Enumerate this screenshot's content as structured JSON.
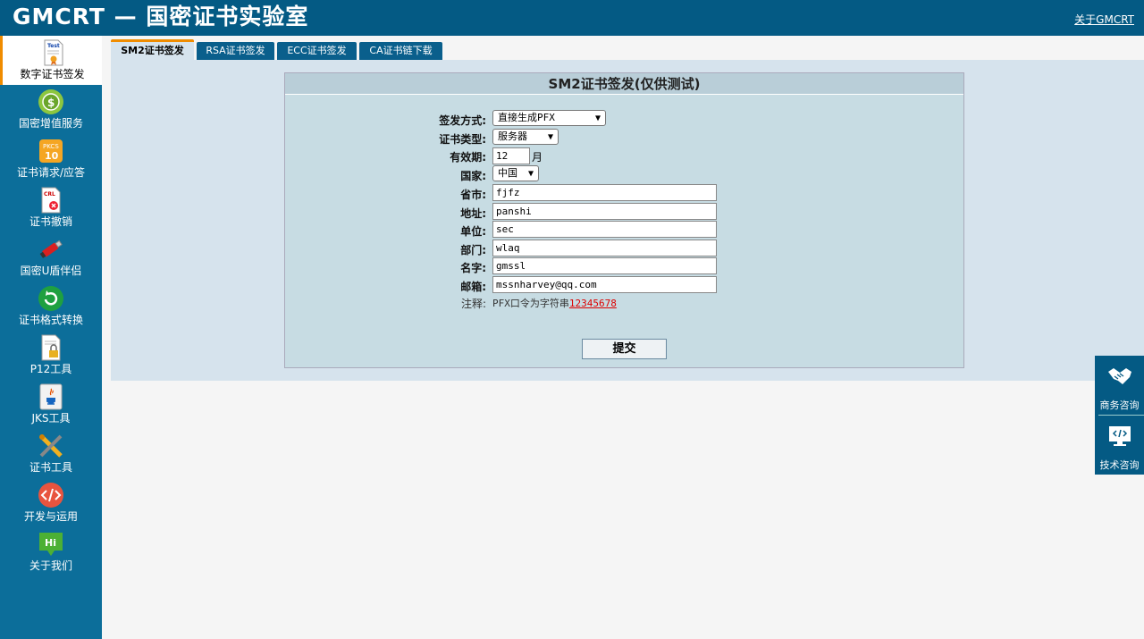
{
  "header": {
    "title": "GMCRT — 国密证书实验室",
    "about": "关于GMCRT"
  },
  "sidebar": {
    "items": [
      {
        "label": "数字证书签发",
        "icon": "certificate-icon"
      },
      {
        "label": "国密增值服务",
        "icon": "coin-icon"
      },
      {
        "label": "证书请求/应答",
        "icon": "pkcs10-icon"
      },
      {
        "label": "证书撤销",
        "icon": "crl-icon"
      },
      {
        "label": "国密U盾伴侣",
        "icon": "usb-key-icon"
      },
      {
        "label": "证书格式转换",
        "icon": "refresh-icon"
      },
      {
        "label": "P12工具",
        "icon": "lock-document-icon"
      },
      {
        "label": "JKS工具",
        "icon": "java-icon"
      },
      {
        "label": "证书工具",
        "icon": "tools-icon"
      },
      {
        "label": "开发与运用",
        "icon": "code-icon"
      },
      {
        "label": "关于我们",
        "icon": "hi-icon"
      }
    ]
  },
  "tabs": [
    {
      "label": "SM2证书签发"
    },
    {
      "label": "RSA证书签发"
    },
    {
      "label": "ECC证书签发"
    },
    {
      "label": "CA证书链下载"
    }
  ],
  "form": {
    "title": "SM2证书签发(仅供测试)",
    "sign_method": {
      "label": "签发方式:",
      "value": "直接生成PFX"
    },
    "cert_type": {
      "label": "证书类型:",
      "value": "服务器"
    },
    "validity": {
      "label": "有效期:",
      "value": "12",
      "unit": "月"
    },
    "country": {
      "label": "国家:",
      "value": "中国"
    },
    "province": {
      "label": "省市:",
      "value": "fjfz"
    },
    "address": {
      "label": "地址:",
      "value": "panshi"
    },
    "org": {
      "label": "单位:",
      "value": "sec"
    },
    "dept": {
      "label": "部门:",
      "value": "wlaq"
    },
    "name": {
      "label": "名字:",
      "value": "gmssl"
    },
    "email": {
      "label": "邮箱:",
      "value": "mssnharvey@qq.com"
    },
    "note": {
      "label": "注释:",
      "text": "PFX口令为字符串",
      "password": "12345678"
    },
    "submit": "提交"
  },
  "float": {
    "business": "商务咨询",
    "tech": "技术咨询"
  }
}
